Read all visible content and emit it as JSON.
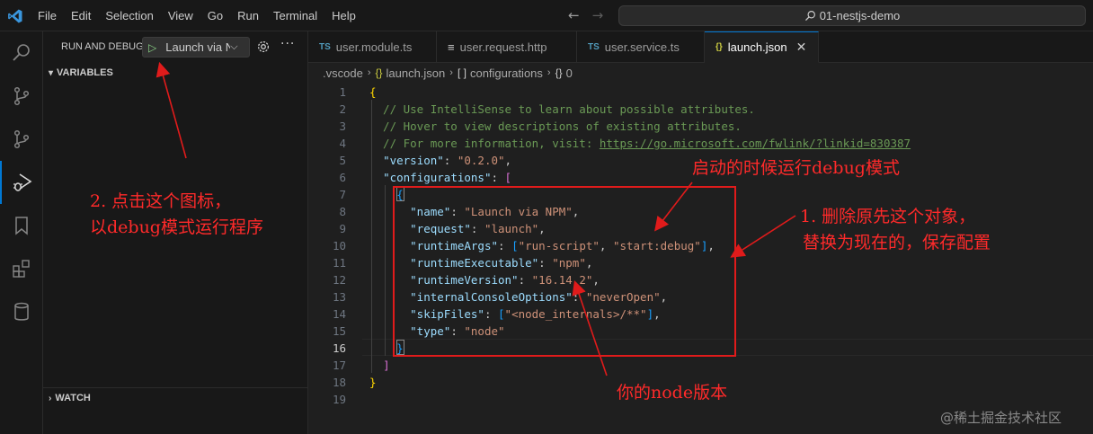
{
  "titlebar": {
    "menu": [
      "File",
      "Edit",
      "Selection",
      "View",
      "Go",
      "Run",
      "Terminal",
      "Help"
    ],
    "search_text": "01-nestjs-demo"
  },
  "sidebar": {
    "title": "RUN AND DEBUG",
    "launch_config": "Launch via NPM",
    "sections": [
      "VARIABLES",
      "WATCH"
    ]
  },
  "tabs": [
    {
      "icon": "TS",
      "label": "user.module.ts",
      "active": false
    },
    {
      "icon": "≡",
      "label": "user.request.http",
      "active": false
    },
    {
      "icon": "TS",
      "label": "user.service.ts",
      "active": false
    },
    {
      "icon": "{}",
      "label": "launch.json",
      "active": true
    }
  ],
  "breadcrumb": [
    ".vscode",
    "launch.json",
    "configurations",
    "0"
  ],
  "editor": {
    "current_line": 16,
    "lines": [
      {
        "n": "1",
        "t": [
          [
            "c-brace",
            "{"
          ]
        ]
      },
      {
        "n": "2",
        "t": [
          [
            "c-comment",
            "  // Use IntelliSense to learn about possible attributes."
          ]
        ]
      },
      {
        "n": "3",
        "t": [
          [
            "c-comment",
            "  // Hover to view descriptions of existing attributes."
          ]
        ]
      },
      {
        "n": "4",
        "t": [
          [
            "c-comment",
            "  // For more information, visit: "
          ],
          [
            "c-link",
            "https://go.microsoft.com/fwlink/?linkid=830387"
          ]
        ]
      },
      {
        "n": "5",
        "t": [
          [
            "c-p",
            "  "
          ],
          [
            "c-key",
            "\"version\""
          ],
          [
            "c-p",
            ": "
          ],
          [
            "c-str",
            "\"0.2.0\""
          ],
          [
            "c-p",
            ","
          ]
        ]
      },
      {
        "n": "6",
        "t": [
          [
            "c-p",
            "  "
          ],
          [
            "c-key",
            "\"configurations\""
          ],
          [
            "c-p",
            ": "
          ],
          [
            "c-brack",
            "["
          ]
        ]
      },
      {
        "n": "7",
        "t": [
          [
            "c-p",
            "    "
          ],
          [
            "c-cur",
            "{"
          ]
        ]
      },
      {
        "n": "8",
        "t": [
          [
            "c-p",
            "      "
          ],
          [
            "c-key",
            "\"name\""
          ],
          [
            "c-p",
            ": "
          ],
          [
            "c-str",
            "\"Launch via NPM\""
          ],
          [
            "c-p",
            ","
          ]
        ]
      },
      {
        "n": "9",
        "t": [
          [
            "c-p",
            "      "
          ],
          [
            "c-key",
            "\"request\""
          ],
          [
            "c-p",
            ": "
          ],
          [
            "c-str",
            "\"launch\""
          ],
          [
            "c-p",
            ","
          ]
        ]
      },
      {
        "n": "10",
        "t": [
          [
            "c-p",
            "      "
          ],
          [
            "c-key",
            "\"runtimeArgs\""
          ],
          [
            "c-p",
            ": "
          ],
          [
            "c-cur",
            "["
          ],
          [
            "c-str",
            "\"run-script\""
          ],
          [
            "c-p",
            ", "
          ],
          [
            "c-str",
            "\"start:debug\""
          ],
          [
            "c-cur",
            "]"
          ],
          [
            "c-p",
            ","
          ]
        ]
      },
      {
        "n": "11",
        "t": [
          [
            "c-p",
            "      "
          ],
          [
            "c-key",
            "\"runtimeExecutable\""
          ],
          [
            "c-p",
            ": "
          ],
          [
            "c-str",
            "\"npm\""
          ],
          [
            "c-p",
            ","
          ]
        ]
      },
      {
        "n": "12",
        "t": [
          [
            "c-p",
            "      "
          ],
          [
            "c-key",
            "\"runtimeVersion\""
          ],
          [
            "c-p",
            ": "
          ],
          [
            "c-str",
            "\"16.14.2\""
          ],
          [
            "c-p",
            ","
          ]
        ]
      },
      {
        "n": "13",
        "t": [
          [
            "c-p",
            "      "
          ],
          [
            "c-key",
            "\"internalConsoleOptions\""
          ],
          [
            "c-p",
            ": "
          ],
          [
            "c-str",
            "\"neverOpen\""
          ],
          [
            "c-p",
            ","
          ]
        ]
      },
      {
        "n": "14",
        "t": [
          [
            "c-p",
            "      "
          ],
          [
            "c-key",
            "\"skipFiles\""
          ],
          [
            "c-p",
            ": "
          ],
          [
            "c-cur",
            "["
          ],
          [
            "c-str",
            "\"<node_internals>/**\""
          ],
          [
            "c-cur",
            "]"
          ],
          [
            "c-p",
            ","
          ]
        ]
      },
      {
        "n": "15",
        "t": [
          [
            "c-p",
            "      "
          ],
          [
            "c-key",
            "\"type\""
          ],
          [
            "c-p",
            ": "
          ],
          [
            "c-str",
            "\"node\""
          ]
        ]
      },
      {
        "n": "16",
        "t": [
          [
            "c-p",
            "    "
          ],
          [
            "c-cur",
            "}"
          ]
        ]
      },
      {
        "n": "17",
        "t": [
          [
            "c-p",
            "  "
          ],
          [
            "c-brack",
            "]"
          ]
        ]
      },
      {
        "n": "18",
        "t": [
          [
            "c-brace",
            "}"
          ]
        ]
      },
      {
        "n": "19",
        "t": []
      }
    ]
  },
  "annotations": {
    "click_icon_line1": "2.  点击这个图标，",
    "click_icon_line2": "以debug模式运行程序",
    "debug_mode": "启动的时候运行debug模式",
    "delete_line1": "1. 删除原先这个对象，",
    "delete_line2": "替换为现在的，保存配置",
    "node_version": "你的node版本"
  },
  "watermark": "@稀土掘金技术社区",
  "colors": {
    "accent": "#0078d4",
    "annotation": "#ff2a2a"
  }
}
